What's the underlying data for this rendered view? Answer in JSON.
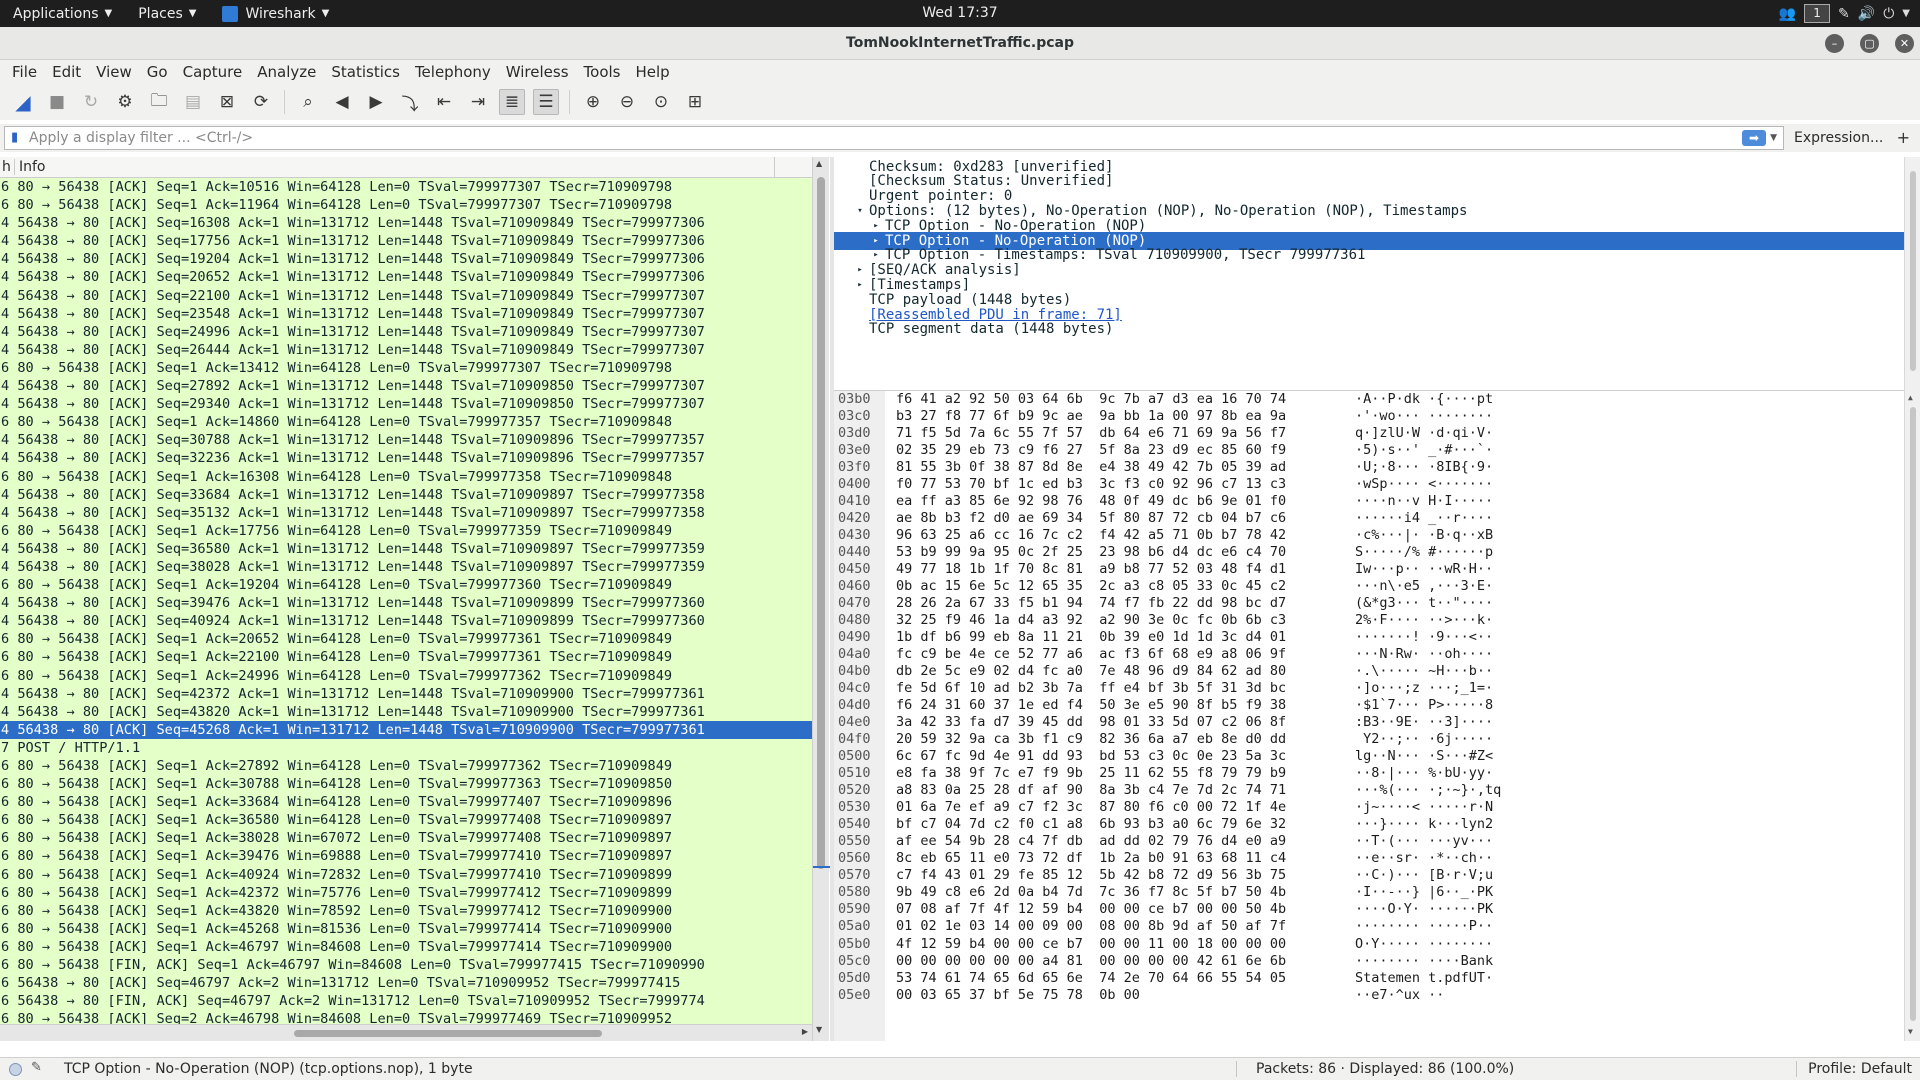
{
  "topbar": {
    "applications": "Applications",
    "places": "Places",
    "app": "Wireshark",
    "clock": "Wed 17:37",
    "workspace": "1"
  },
  "window": {
    "title": "TomNookInternetTraffic.pcap"
  },
  "menubar": [
    "File",
    "Edit",
    "View",
    "Go",
    "Capture",
    "Analyze",
    "Statistics",
    "Telephony",
    "Wireless",
    "Tools",
    "Help"
  ],
  "filter": {
    "placeholder": "Apply a display filter ... <Ctrl-/>",
    "expression": "Expression...",
    "add": "+"
  },
  "packet_list": {
    "header_col1": "h",
    "header_col2": "Info",
    "rows": [
      "6 80 → 56438 [ACK] Seq=1 Ack=10516 Win=64128 Len=0 TSval=799977307 TSecr=710909798",
      "6 80 → 56438 [ACK] Seq=1 Ack=11964 Win=64128 Len=0 TSval=799977307 TSecr=710909798",
      "4 56438 → 80 [ACK] Seq=16308 Ack=1 Win=131712 Len=1448 TSval=710909849 TSecr=799977306",
      "4 56438 → 80 [ACK] Seq=17756 Ack=1 Win=131712 Len=1448 TSval=710909849 TSecr=799977306",
      "4 56438 → 80 [ACK] Seq=19204 Ack=1 Win=131712 Len=1448 TSval=710909849 TSecr=799977306",
      "4 56438 → 80 [ACK] Seq=20652 Ack=1 Win=131712 Len=1448 TSval=710909849 TSecr=799977306",
      "4 56438 → 80 [ACK] Seq=22100 Ack=1 Win=131712 Len=1448 TSval=710909849 TSecr=799977307",
      "4 56438 → 80 [ACK] Seq=23548 Ack=1 Win=131712 Len=1448 TSval=710909849 TSecr=799977307",
      "4 56438 → 80 [ACK] Seq=24996 Ack=1 Win=131712 Len=1448 TSval=710909849 TSecr=799977307",
      "4 56438 → 80 [ACK] Seq=26444 Ack=1 Win=131712 Len=1448 TSval=710909849 TSecr=799977307",
      "6 80 → 56438 [ACK] Seq=1 Ack=13412 Win=64128 Len=0 TSval=799977307 TSecr=710909798",
      "4 56438 → 80 [ACK] Seq=27892 Ack=1 Win=131712 Len=1448 TSval=710909850 TSecr=799977307",
      "4 56438 → 80 [ACK] Seq=29340 Ack=1 Win=131712 Len=1448 TSval=710909850 TSecr=799977307",
      "6 80 → 56438 [ACK] Seq=1 Ack=14860 Win=64128 Len=0 TSval=799977357 TSecr=710909848",
      "4 56438 → 80 [ACK] Seq=30788 Ack=1 Win=131712 Len=1448 TSval=710909896 TSecr=799977357",
      "4 56438 → 80 [ACK] Seq=32236 Ack=1 Win=131712 Len=1448 TSval=710909896 TSecr=799977357",
      "6 80 → 56438 [ACK] Seq=1 Ack=16308 Win=64128 Len=0 TSval=799977358 TSecr=710909848",
      "4 56438 → 80 [ACK] Seq=33684 Ack=1 Win=131712 Len=1448 TSval=710909897 TSecr=799977358",
      "4 56438 → 80 [ACK] Seq=35132 Ack=1 Win=131712 Len=1448 TSval=710909897 TSecr=799977358",
      "6 80 → 56438 [ACK] Seq=1 Ack=17756 Win=64128 Len=0 TSval=799977359 TSecr=710909849",
      "4 56438 → 80 [ACK] Seq=36580 Ack=1 Win=131712 Len=1448 TSval=710909897 TSecr=799977359",
      "4 56438 → 80 [ACK] Seq=38028 Ack=1 Win=131712 Len=1448 TSval=710909897 TSecr=799977359",
      "6 80 → 56438 [ACK] Seq=1 Ack=19204 Win=64128 Len=0 TSval=799977360 TSecr=710909849",
      "4 56438 → 80 [ACK] Seq=39476 Ack=1 Win=131712 Len=1448 TSval=710909899 TSecr=799977360",
      "4 56438 → 80 [ACK] Seq=40924 Ack=1 Win=131712 Len=1448 TSval=710909899 TSecr=799977360",
      "6 80 → 56438 [ACK] Seq=1 Ack=20652 Win=64128 Len=0 TSval=799977361 TSecr=710909849",
      "6 80 → 56438 [ACK] Seq=1 Ack=22100 Win=64128 Len=0 TSval=799977361 TSecr=710909849",
      "6 80 → 56438 [ACK] Seq=1 Ack=24996 Win=64128 Len=0 TSval=799977362 TSecr=710909849",
      "4 56438 → 80 [ACK] Seq=42372 Ack=1 Win=131712 Len=1448 TSval=710909900 TSecr=799977361",
      "4 56438 → 80 [ACK] Seq=43820 Ack=1 Win=131712 Len=1448 TSval=710909900 TSecr=799977361",
      "4 56438 → 80 [ACK] Seq=45268 Ack=1 Win=131712 Len=1448 TSval=710909900 TSecr=799977361",
      "7 POST / HTTP/1.1",
      "6 80 → 56438 [ACK] Seq=1 Ack=27892 Win=64128 Len=0 TSval=799977362 TSecr=710909849",
      "6 80 → 56438 [ACK] Seq=1 Ack=30788 Win=64128 Len=0 TSval=799977363 TSecr=710909850",
      "6 80 → 56438 [ACK] Seq=1 Ack=33684 Win=64128 Len=0 TSval=799977407 TSecr=710909896",
      "6 80 → 56438 [ACK] Seq=1 Ack=36580 Win=64128 Len=0 TSval=799977408 TSecr=710909897",
      "6 80 → 56438 [ACK] Seq=1 Ack=38028 Win=67072 Len=0 TSval=799977408 TSecr=710909897",
      "6 80 → 56438 [ACK] Seq=1 Ack=39476 Win=69888 Len=0 TSval=799977410 TSecr=710909897",
      "6 80 → 56438 [ACK] Seq=1 Ack=40924 Win=72832 Len=0 TSval=799977410 TSecr=710909899",
      "6 80 → 56438 [ACK] Seq=1 Ack=42372 Win=75776 Len=0 TSval=799977412 TSecr=710909899",
      "6 80 → 56438 [ACK] Seq=1 Ack=43820 Win=78592 Len=0 TSval=799977412 TSecr=710909900",
      "6 80 → 56438 [ACK] Seq=1 Ack=45268 Win=81536 Len=0 TSval=799977414 TSecr=710909900",
      "6 80 → 56438 [ACK] Seq=1 Ack=46797 Win=84608 Len=0 TSval=799977414 TSecr=710909900",
      "6 80 → 56438 [FIN, ACK] Seq=1 Ack=46797 Win=84608 Len=0 TSval=799977415 TSecr=71090990",
      "6 56438 → 80 [ACK] Seq=46797 Ack=2 Win=131712 Len=0 TSval=710909952 TSecr=799977415",
      "6 56438 → 80 [FIN, ACK] Seq=46797 Ack=2 Win=131712 Len=0 TSval=710909952 TSecr=7999774",
      "6 80 → 56438 [ACK] Seq=2 Ack=46798 Win=84608 Len=0 TSval=799977469 TSecr=710909952"
    ],
    "selected_index": 30
  },
  "details": {
    "rows": [
      {
        "indent": 0,
        "toggle": "",
        "text": "Checksum: 0xd283 [unverified]"
      },
      {
        "indent": 0,
        "toggle": "",
        "text": "[Checksum Status: Unverified]"
      },
      {
        "indent": 0,
        "toggle": "",
        "text": "Urgent pointer: 0"
      },
      {
        "indent": 0,
        "toggle": "▾",
        "text": "Options: (12 bytes), No-Operation (NOP), No-Operation (NOP), Timestamps"
      },
      {
        "indent": 1,
        "toggle": "▸",
        "text": "TCP Option - No-Operation (NOP)"
      },
      {
        "indent": 1,
        "toggle": "▸",
        "text": "TCP Option - No-Operation (NOP)",
        "selected": true
      },
      {
        "indent": 1,
        "toggle": "▸",
        "text": "TCP Option - Timestamps: TSval 710909900, TSecr 799977361"
      },
      {
        "indent": 0,
        "toggle": "▸",
        "text": "[SEQ/ACK analysis]"
      },
      {
        "indent": 0,
        "toggle": "▸",
        "text": "[Timestamps]"
      },
      {
        "indent": 0,
        "toggle": "",
        "text": "TCP payload (1448 bytes)"
      },
      {
        "indent": 0,
        "toggle": "",
        "text": "[Reassembled PDU in frame: 71]",
        "link": true
      },
      {
        "indent": 0,
        "toggle": "",
        "text": "TCP segment data (1448 bytes)"
      }
    ]
  },
  "bytes": {
    "offsets": [
      "03b0",
      "03c0",
      "03d0",
      "03e0",
      "03f0",
      "0400",
      "0410",
      "0420",
      "0430",
      "0440",
      "0450",
      "0460",
      "0470",
      "0480",
      "0490",
      "04a0",
      "04b0",
      "04c0",
      "04d0",
      "04e0",
      "04f0",
      "0500",
      "0510",
      "0520",
      "0530",
      "0540",
      "0550",
      "0560",
      "0570",
      "0580",
      "0590",
      "05a0",
      "05b0",
      "05c0",
      "05d0",
      "05e0"
    ],
    "hex": [
      "f6 41 a2 92 50 03 64 6b  9c 7b a7 d3 ea 16 70 74",
      "b3 27 f8 77 6f b9 9c ae  9a bb 1a 00 97 8b ea 9a",
      "71 f5 5d 7a 6c 55 7f 57  db 64 e6 71 69 9a 56 f7",
      "02 35 29 eb 73 c9 f6 27  5f 8a 23 d9 ec 85 60 f9",
      "81 55 3b 0f 38 87 8d 8e  e4 38 49 42 7b 05 39 ad",
      "f0 77 53 70 bf 1c ed b3  3c f3 c0 92 96 c7 13 c3",
      "ea ff a3 85 6e 92 98 76  48 0f 49 dc b6 9e 01 f0",
      "ae 8b b3 f2 d0 ae 69 34  5f 80 87 72 cb 04 b7 c6",
      "96 63 25 a6 cc 16 7c c2  f4 42 a5 71 0b b7 78 42",
      "53 b9 99 9a 95 0c 2f 25  23 98 b6 d4 dc e6 c4 70",
      "49 77 18 1b 1f 70 8c 81  a9 b8 77 52 03 48 f4 d1",
      "0b ac 15 6e 5c 12 65 35  2c a3 c8 05 33 0c 45 c2",
      "28 26 2a 67 33 f5 b1 94  74 f7 fb 22 dd 98 bc d7",
      "32 25 f9 46 1a d4 a3 92  a2 90 3e 0c fc 0b 6b c3",
      "1b df b6 99 eb 8a 11 21  0b 39 e0 1d 1d 3c d4 01",
      "fc c9 be 4e ce 52 77 a6  ac f3 6f 68 e9 a8 06 9f",
      "db 2e 5c e9 02 d4 fc a0  7e 48 96 d9 84 62 ad 80",
      "fe 5d 6f 10 ad b2 3b 7a  ff e4 bf 3b 5f 31 3d bc",
      "f6 24 31 60 37 1e ed f4  50 3e e5 90 8f b5 f9 38",
      "3a 42 33 fa d7 39 45 dd  98 01 33 5d 07 c2 06 8f",
      "20 59 32 9a ca 3b f1 c9  82 36 6a a7 eb 8e d0 dd",
      "6c 67 fc 9d 4e 91 dd 93  bd 53 c3 0c 0e 23 5a 3c",
      "e8 fa 38 9f 7c e7 f9 9b  25 11 62 55 f8 79 79 b9",
      "a8 83 0a 25 28 df af 90  8a 3b c4 7e 7d 2c 74 71",
      "01 6a 7e ef a9 c7 f2 3c  87 80 f6 c0 00 72 1f 4e",
      "bf c7 04 7d c2 f0 c1 a8  6b 93 b3 a0 6c 79 6e 32",
      "af ee 54 9b 28 c4 7f db  ad dd 02 79 76 d4 e0 a9",
      "8c eb 65 11 e0 73 72 df  1b 2a b0 91 63 68 11 c4",
      "c7 f4 43 01 29 fe 85 12  5b 42 b8 72 d9 56 3b 75",
      "9b 49 c8 e6 2d 0a b4 7d  7c 36 f7 8c 5f b7 50 4b",
      "07 08 af 7f 4f 12 59 b4  00 00 ce b7 00 00 50 4b",
      "01 02 1e 03 14 00 09 00  08 00 8b 9d af 50 af 7f",
      "4f 12 59 b4 00 00 ce b7  00 00 11 00 18 00 00 00",
      "00 00 00 00 00 00 a4 81  00 00 00 00 42 61 6e 6b",
      "53 74 61 74 65 6d 65 6e  74 2e 70 64 66 55 54 05",
      "00 03 65 37 bf 5e 75 78  0b 00"
    ],
    "ascii": [
      "·A··P·dk ·{····pt",
      "·'·wo··· ········",
      "q·]zlU·W ·d·qi·V·",
      "·5)·s··' _·#···`·",
      "·U;·8··· ·8IB{·9·",
      "·wSp···· <·······",
      "····n··v H·I·····",
      "······i4 _··r····",
      "·c%···|· ·B·q··xB",
      "S·····/% #······p",
      "Iw···p·· ··wR·H··",
      "···n\\·e5 ,···3·E·",
      "(&*g3··· t··\"····",
      "2%·F···· ··>···k·",
      "·······! ·9···<··",
      "···N·Rw· ··oh····",
      "·.\\····· ~H···b··",
      "·]o···;z ···;_1=·",
      "·$1`7··· P>·····8",
      ":B3··9E· ··3]····",
      " Y2··;·· ·6j·····",
      "lg··N··· ·S···#Z<",
      "··8·|··· %·bU·yy·",
      "···%(··· ·;·~}·,tq",
      "·j~····< ·····r·N",
      "···}···· k···lyn2",
      "··T·(··· ···yv···",
      "··e··sr· ·*··ch··",
      "··C·)··· [B·r·V;u",
      "·I··-··} |6··_·PK",
      "····O·Y· ······PK",
      "········ ·····P··",
      "O·Y····· ········",
      "········ ····Bank",
      "Statemen t.pdfUT·",
      "··e7·^ux ··"
    ]
  },
  "status": {
    "message": "TCP Option - No-Operation (NOP) (tcp.options.nop), 1 byte",
    "packets": "Packets: 86 · Displayed: 86 (100.0%)",
    "profile": "Profile: Default"
  }
}
